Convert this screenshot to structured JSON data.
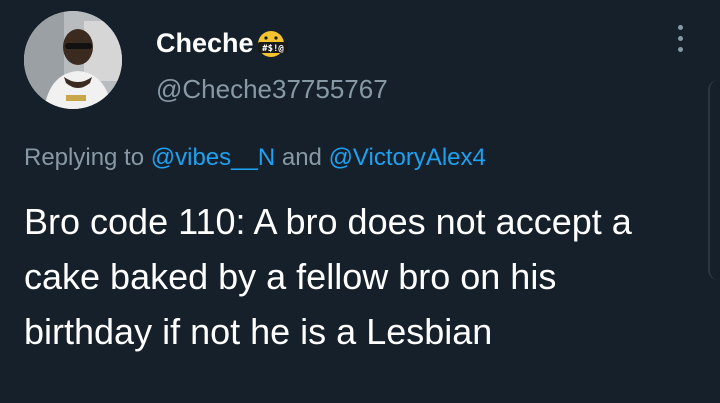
{
  "author": {
    "display_name": "Cheche",
    "handle": "@Cheche37755767",
    "emoji": "face-with-symbols-on-mouth"
  },
  "reply": {
    "prefix": "Replying to",
    "mention_1": "@vibes__N",
    "joiner": "and",
    "mention_2": "@VictoryAlex4"
  },
  "tweet": {
    "text": "Bro code 110: A bro does not accept a cake baked by a fellow bro on his birthday if not he is a Lesbian"
  },
  "colors": {
    "background": "#15202b",
    "text": "#ffffff",
    "secondary": "#8899a6",
    "link": "#1da1f2"
  }
}
